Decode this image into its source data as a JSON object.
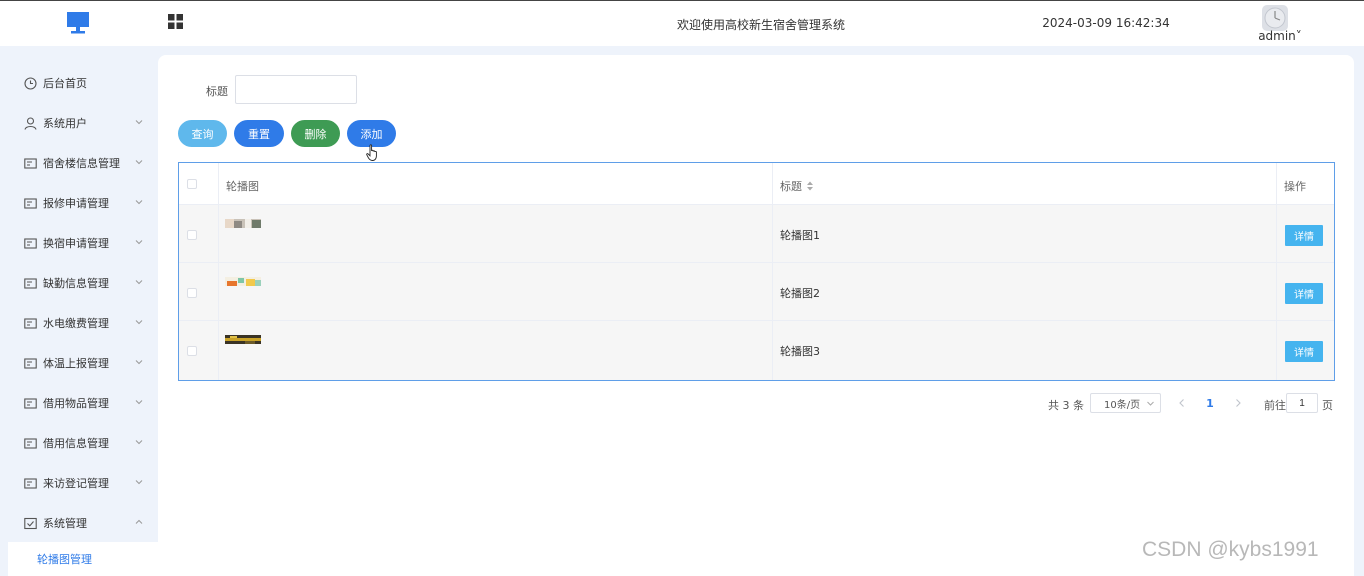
{
  "header": {
    "title": "欢迎使用高校新生宿舍管理系统",
    "datetime": "2024-03-09 16:42:34",
    "user": "admin˅",
    "logo_icon": "monitor-icon",
    "menu_icon": "grid-icon"
  },
  "sidebar": {
    "items": [
      {
        "label": "后台首页",
        "icon": "clock-icon"
      },
      {
        "label": "系统用户",
        "icon": "user-icon"
      },
      {
        "label": "宿舍楼信息管理",
        "icon": "card-icon"
      },
      {
        "label": "报修申请管理",
        "icon": "card-icon"
      },
      {
        "label": "换宿申请管理",
        "icon": "card-icon"
      },
      {
        "label": "缺勤信息管理",
        "icon": "card-icon"
      },
      {
        "label": "水电缴费管理",
        "icon": "card-icon"
      },
      {
        "label": "体温上报管理",
        "icon": "card-icon"
      },
      {
        "label": "借用物品管理",
        "icon": "card-icon"
      },
      {
        "label": "借用信息管理",
        "icon": "card-icon"
      },
      {
        "label": "来访登记管理",
        "icon": "card-icon"
      },
      {
        "label": "系统管理",
        "icon": "checkbox-icon"
      }
    ],
    "sub_item": "轮播图管理"
  },
  "filter": {
    "label": "标题",
    "value": ""
  },
  "buttons": {
    "query": "查询",
    "reset": "重置",
    "delete": "删除",
    "add": "添加"
  },
  "table": {
    "headers": {
      "image": "轮播图",
      "title": "标题",
      "actions": "操作"
    },
    "rows": [
      {
        "title": "轮播图1",
        "action": "详情"
      },
      {
        "title": "轮播图2",
        "action": "详情"
      },
      {
        "title": "轮播图3",
        "action": "详情"
      }
    ]
  },
  "pagination": {
    "total": "共 3 条",
    "page_size": "10条/页",
    "current": "1",
    "goto_label": "前往",
    "goto_value": "1",
    "page_unit": "页"
  },
  "watermark": "CSDN @kybs1991",
  "colors": {
    "primary": "#2f7be8",
    "query": "#5fb8ec",
    "delete": "#3e9b54",
    "detail": "#45b4ef",
    "background": "#eef3fb"
  }
}
